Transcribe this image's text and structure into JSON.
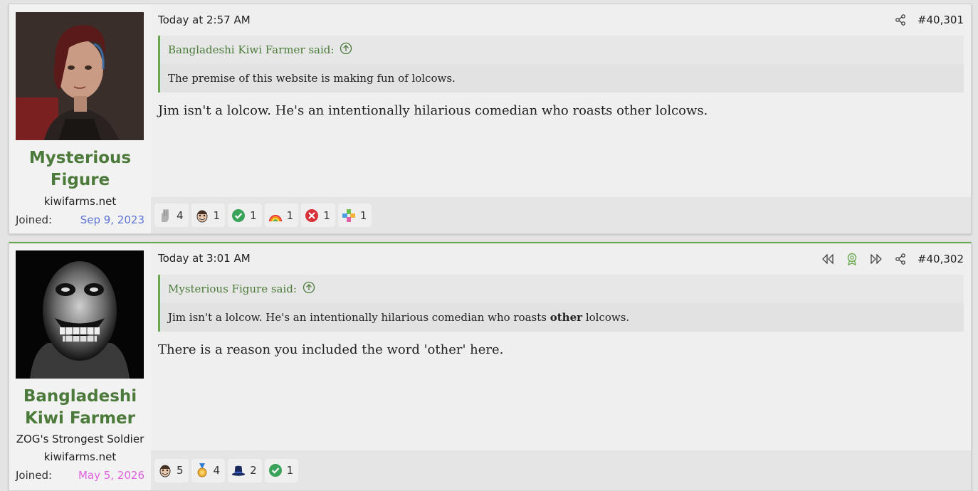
{
  "posts": [
    {
      "author": "Mysterious Figure",
      "title": "",
      "site": "kiwifarms.net",
      "joined_label": "Joined:",
      "joined_date": "Sep 9, 2023",
      "timestamp": "Today at 2:57 AM",
      "post_number": "#40,301",
      "quote": {
        "author_label": "Bangladeshi Kiwi Farmer said:",
        "text": "The premise of this website is making fun of lolcows."
      },
      "message": "Jim isn't a lolcow. He's an intentionally hilarious comedian who roasts other lolcows.",
      "reactions": [
        {
          "icon": "hand-icon",
          "count": "4"
        },
        {
          "icon": "face-icon",
          "count": "1"
        },
        {
          "icon": "checkmark-icon",
          "count": "1"
        },
        {
          "icon": "rainbow-icon",
          "count": "1"
        },
        {
          "icon": "x-icon",
          "count": "1"
        },
        {
          "icon": "puzzle-icon",
          "count": "1"
        }
      ]
    },
    {
      "author": "Bangladeshi Kiwi Farmer",
      "title": "ZOG's Strongest Soldier",
      "site": "kiwifarms.net",
      "joined_label": "Joined:",
      "joined_date": "May 5, 2026",
      "timestamp": "Today at 3:01 AM",
      "post_number": "#40,302",
      "quote": {
        "author_label": "Mysterious Figure said:",
        "text_before": "Jim isn't a lolcow. He's an intentionally hilarious comedian who roasts ",
        "text_bold": "other",
        "text_after": " lolcows."
      },
      "message": "There is a reason you included the word 'other' here.",
      "reactions": [
        {
          "icon": "face-icon",
          "count": "5"
        },
        {
          "icon": "medal-icon",
          "count": "4"
        },
        {
          "icon": "top-hat-icon",
          "count": "2"
        },
        {
          "icon": "checkmark-icon",
          "count": "1"
        }
      ]
    }
  ],
  "colors": {
    "accent": "#6aa84f",
    "username": "#4b7a3a",
    "joined_post1": "#5e74d4",
    "joined_post2": "#e05fe0"
  }
}
